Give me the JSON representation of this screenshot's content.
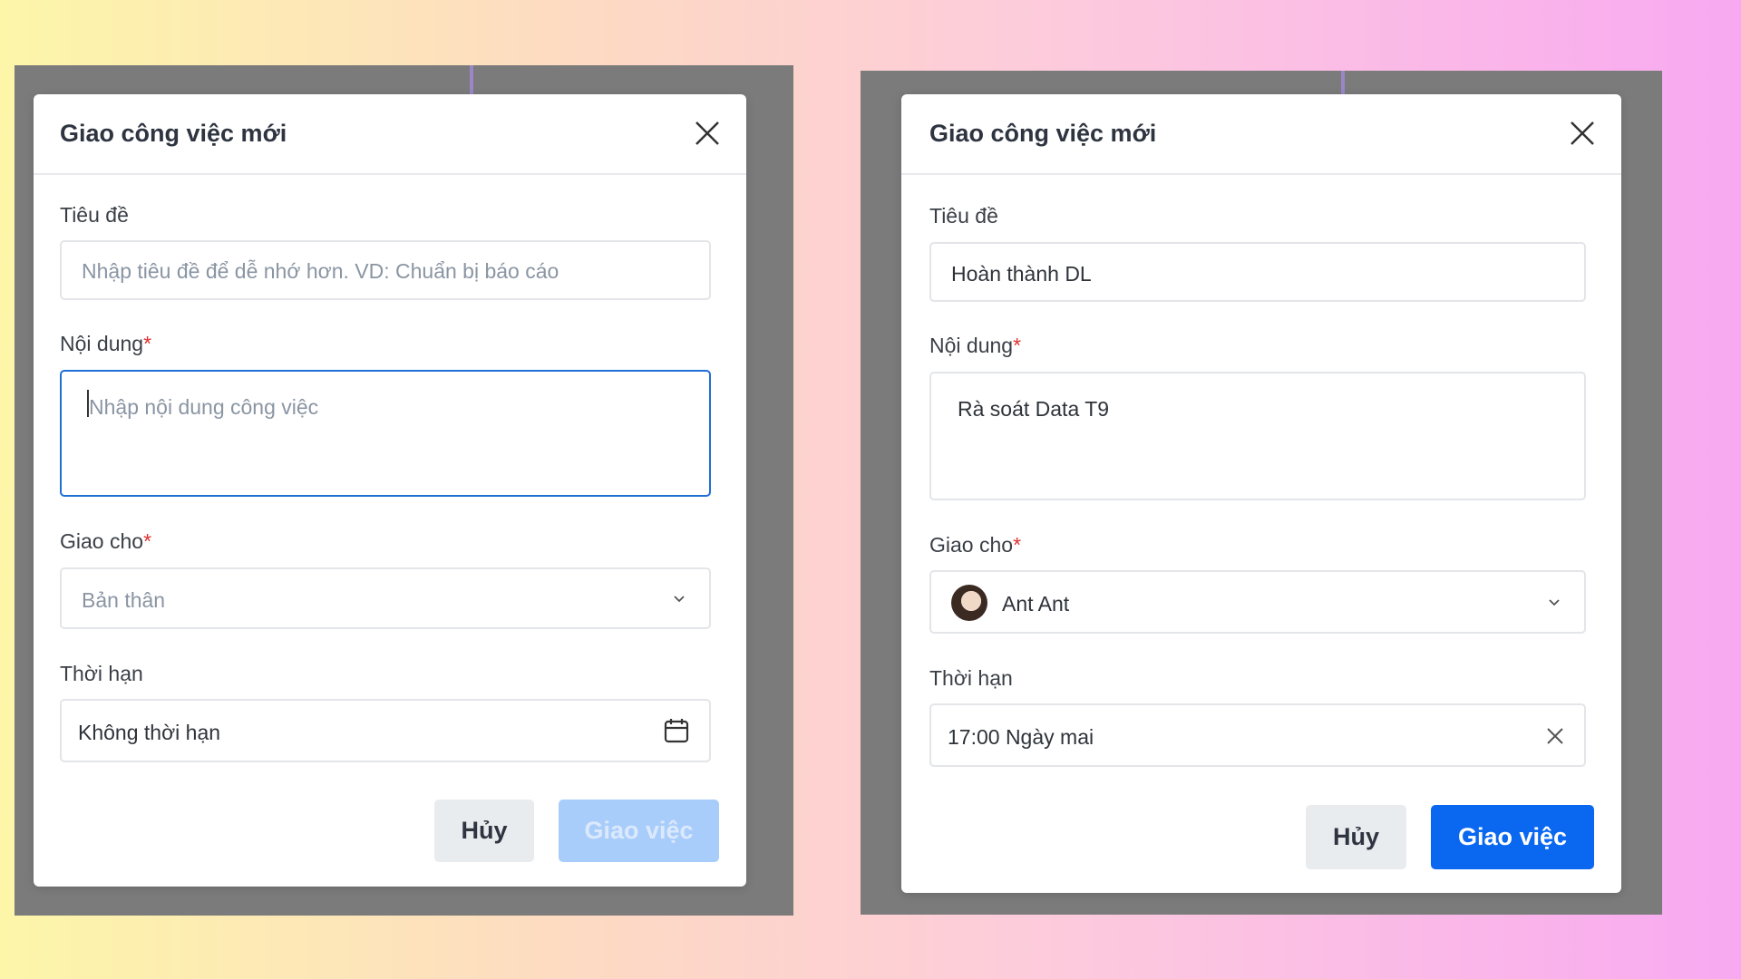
{
  "left_dialog": {
    "title": "Giao công việc mới",
    "title_label": "Tiêu đề",
    "title_placeholder": "Nhập tiêu đề để dễ nhớ hơn. VD: Chuẩn bị báo cáo",
    "content_label": "Nội dung",
    "content_placeholder": "Nhập nội dung công việc",
    "assign_label": "Giao cho",
    "assign_value": "Bản thân",
    "deadline_label": "Thời hạn",
    "deadline_value": "Không thời hạn",
    "deadline_icon": "calendar-icon",
    "cancel_label": "Hủy",
    "submit_label": "Giao việc",
    "submit_state": "disabled"
  },
  "right_dialog": {
    "title": "Giao công việc mới",
    "title_label": "Tiêu đề",
    "title_value": "Hoàn thành DL",
    "content_label": "Nội dung",
    "content_value": "Rà soát Data T9",
    "assign_label": "Giao cho",
    "assign_value": "Ant Ant",
    "deadline_label": "Thời hạn",
    "deadline_value": "17:00 Ngày mai",
    "deadline_icon": "clear-icon",
    "cancel_label": "Hủy",
    "submit_label": "Giao việc",
    "submit_state": "enabled"
  },
  "required_mark": "*",
  "colors": {
    "primary": "#0a67f0",
    "primary_disabled": "#a9cdfb",
    "required": "#e03131",
    "focus": "#1f6fd6"
  }
}
